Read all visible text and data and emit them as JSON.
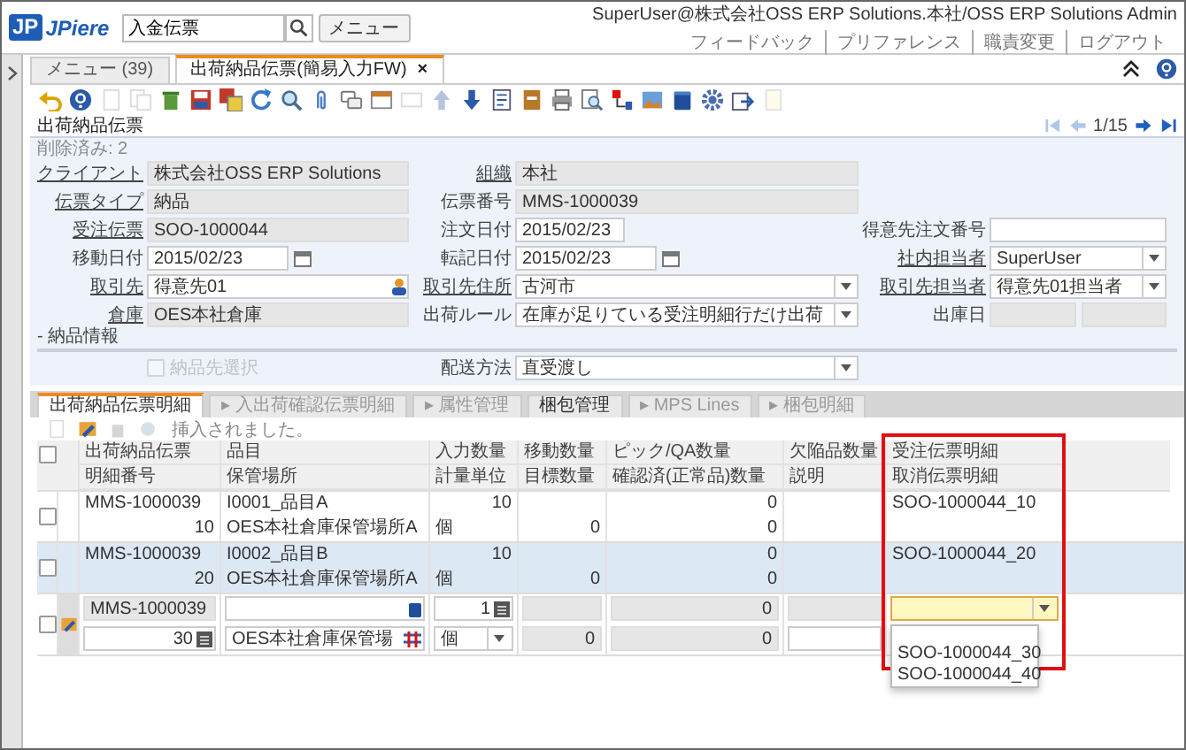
{
  "header": {
    "logo_mark": "JP",
    "logo_text": "JPiere",
    "search": {
      "value": "入金伝票"
    },
    "menu_button": "メニュー",
    "user": "SuperUser@株式会社OSS ERP Solutions.本社/OSS ERP Solutions Admin",
    "links": [
      "フィードバック",
      "プリファレンス",
      "職責変更",
      "ログアウト"
    ]
  },
  "tabs": [
    {
      "label": "メニュー (39)",
      "selected": false
    },
    {
      "label": "出荷納品伝票(簡易入力FW)",
      "selected": true,
      "close": "×"
    }
  ],
  "toolbar": [
    {
      "disabled": false
    },
    {
      "disabled": false
    },
    {
      "disabled": true
    },
    {
      "disabled": true
    },
    {
      "disabled": false
    },
    {
      "disabled": false
    },
    {
      "disabled": false
    },
    {
      "disabled": false
    },
    {
      "disabled": false
    },
    {
      "disabled": false
    },
    {
      "disabled": false
    },
    {
      "disabled": false
    },
    {
      "disabled": true
    },
    {
      "disabled": true
    },
    {
      "disabled": false
    },
    {
      "disabled": false
    },
    {
      "disabled": false
    },
    {
      "disabled": false
    },
    {
      "disabled": false
    },
    {
      "disabled": false
    },
    {
      "disabled": false
    },
    {
      "disabled": false
    },
    {
      "disabled": false
    },
    {
      "disabled": false
    },
    {
      "disabled": true
    }
  ],
  "record": {
    "title": "出荷納品伝票",
    "position": "1/15",
    "nav": [
      {
        "disabled": true
      },
      {
        "disabled": true
      },
      {
        "disabled": false
      },
      {
        "disabled": false
      }
    ]
  },
  "form": {
    "deleted": "削除済み: 2",
    "sections": [
      {
        "rows": [
          [
            {
              "label": "クライアント",
              "link": true,
              "kind": "readonly",
              "value": "株式会社OSS ERP Solutions"
            },
            {
              "label": "組織",
              "link": true,
              "kind": "readonly",
              "value": "本社"
            },
            null
          ],
          [
            {
              "label": "伝票タイプ",
              "link": true,
              "kind": "readonly",
              "value": "納品"
            },
            {
              "label": "伝票番号",
              "link": false,
              "kind": "readonly",
              "value": "MMS-1000039"
            },
            null
          ],
          [
            {
              "label": "受注伝票",
              "link": true,
              "kind": "readonly",
              "value": "SOO-1000044"
            },
            {
              "label": "注文日付",
              "link": false,
              "kind": "short",
              "value": "2015/02/23"
            },
            {
              "label": "得意先注文番号",
              "link": false,
              "kind": "text"
            }
          ],
          [
            {
              "label": "移動日付",
              "link": false,
              "kind": "date",
              "value": "2015/02/23"
            },
            {
              "label": "転記日付",
              "link": false,
              "kind": "date",
              "value": "2015/02/23"
            },
            {
              "label": "社内担当者",
              "link": true,
              "kind": "select",
              "value": "SuperUser"
            }
          ],
          [
            {
              "label": "取引先",
              "link": true,
              "kind": "search",
              "value": "得意先01"
            },
            {
              "label": "取引先住所",
              "link": true,
              "kind": "select",
              "value": "古河市"
            },
            {
              "label": "取引先担当者",
              "link": true,
              "kind": "select",
              "value": "得意先01担当者"
            }
          ],
          [
            {
              "label": "倉庫",
              "link": true,
              "kind": "readonly",
              "value": "OES本社倉庫"
            },
            {
              "label": "出荷ルール",
              "link": false,
              "kind": "select",
              "value": "在庫が足りている受注明細行だけ出荷"
            },
            {
              "label": "出庫日",
              "link": false,
              "kind": "datetime"
            }
          ]
        ]
      },
      {
        "label": "- 納品情報",
        "rows": [
          [
            {
              "label": "納品先選択",
              "kind": "checkbox",
              "checked": false,
              "disabled": true
            },
            {
              "label": "配送方法",
              "link": false,
              "kind": "select",
              "value": "直受渡し"
            },
            null
          ]
        ]
      }
    ]
  },
  "detail_tabs": [
    {
      "label": "出荷納品伝票明細",
      "selected": true,
      "disabled": false
    },
    {
      "label": "入出荷確認伝票明細",
      "selected": false,
      "disabled": true,
      "arrow": "▸"
    },
    {
      "label": "属性管理",
      "selected": false,
      "disabled": true,
      "arrow": "▸"
    },
    {
      "label": "梱包管理",
      "selected": false,
      "disabled": false
    },
    {
      "label": "MPS Lines",
      "selected": false,
      "disabled": true,
      "arrow": "▸"
    },
    {
      "label": "梱包明細",
      "selected": false,
      "disabled": true,
      "arrow": "▸"
    }
  ],
  "grid_toolbar": {
    "buttons": [
      {
        "disabled": true
      },
      {
        "disabled": false
      },
      {
        "disabled": true
      },
      {
        "disabled": true
      }
    ],
    "message": "挿入されました。"
  },
  "grid": {
    "select_all_checked": false,
    "header_top": [
      "出荷納品伝票",
      "品目",
      "入力数量",
      "移動数量",
      "ピック/QA数量",
      "欠陥品数量",
      "受注伝票明細"
    ],
    "header_bottom": [
      "明細番号",
      "保管場所",
      "計量単位",
      "目標数量",
      "確認済(正常品)数量",
      "説明",
      "取消伝票明細"
    ],
    "rows": [
      {
        "checked": false,
        "selected": false,
        "top": {
          "shipment": "MMS-1000039",
          "product": "I0001_品目A",
          "entered_qty": "10",
          "pick_qa_qty": "0",
          "order_line": "SOO-1000044_10"
        },
        "bottom": {
          "line_no": "10",
          "locator": "OES本社倉庫保管場所A",
          "uom": "個",
          "target_qty": "0",
          "confirmed_qty": "0"
        }
      },
      {
        "checked": false,
        "selected": true,
        "top": {
          "shipment": "MMS-1000039",
          "product": "I0002_品目B",
          "entered_qty": "10",
          "pick_qa_qty": "0",
          "order_line": "SOO-1000044_20"
        },
        "bottom": {
          "line_no": "20",
          "locator": "OES本社倉庫保管場所A",
          "uom": "個",
          "target_qty": "0",
          "confirmed_qty": "0"
        }
      }
    ],
    "edit_row": {
      "checked": false,
      "top": {
        "shipment": {
          "kind": "readonly",
          "value": "MMS-1000039"
        },
        "product": {
          "kind": "search"
        },
        "entered_qty": {
          "kind": "number",
          "value": "1"
        },
        "movement_qty": {
          "kind": "readonly"
        },
        "pick_qa_qty": {
          "kind": "readonly",
          "value": "0"
        },
        "defect_qty": {
          "kind": "readonly"
        },
        "order_line": {
          "kind": "select",
          "focused": true
        }
      },
      "bottom": {
        "line_no": {
          "kind": "number",
          "value": "30"
        },
        "locator": {
          "kind": "locator",
          "value": "OES本社倉庫保管場"
        },
        "uom": {
          "kind": "select",
          "focused": false,
          "value": "個"
        },
        "target_qty": {
          "kind": "readonly",
          "value": "0"
        },
        "confirmed_qty": {
          "kind": "readonly",
          "value": "0"
        },
        "description": {
          "kind": "text"
        }
      },
      "dropdown": {
        "options": [
          "SOO-1000044_30",
          "SOO-1000044_40"
        ]
      }
    }
  }
}
